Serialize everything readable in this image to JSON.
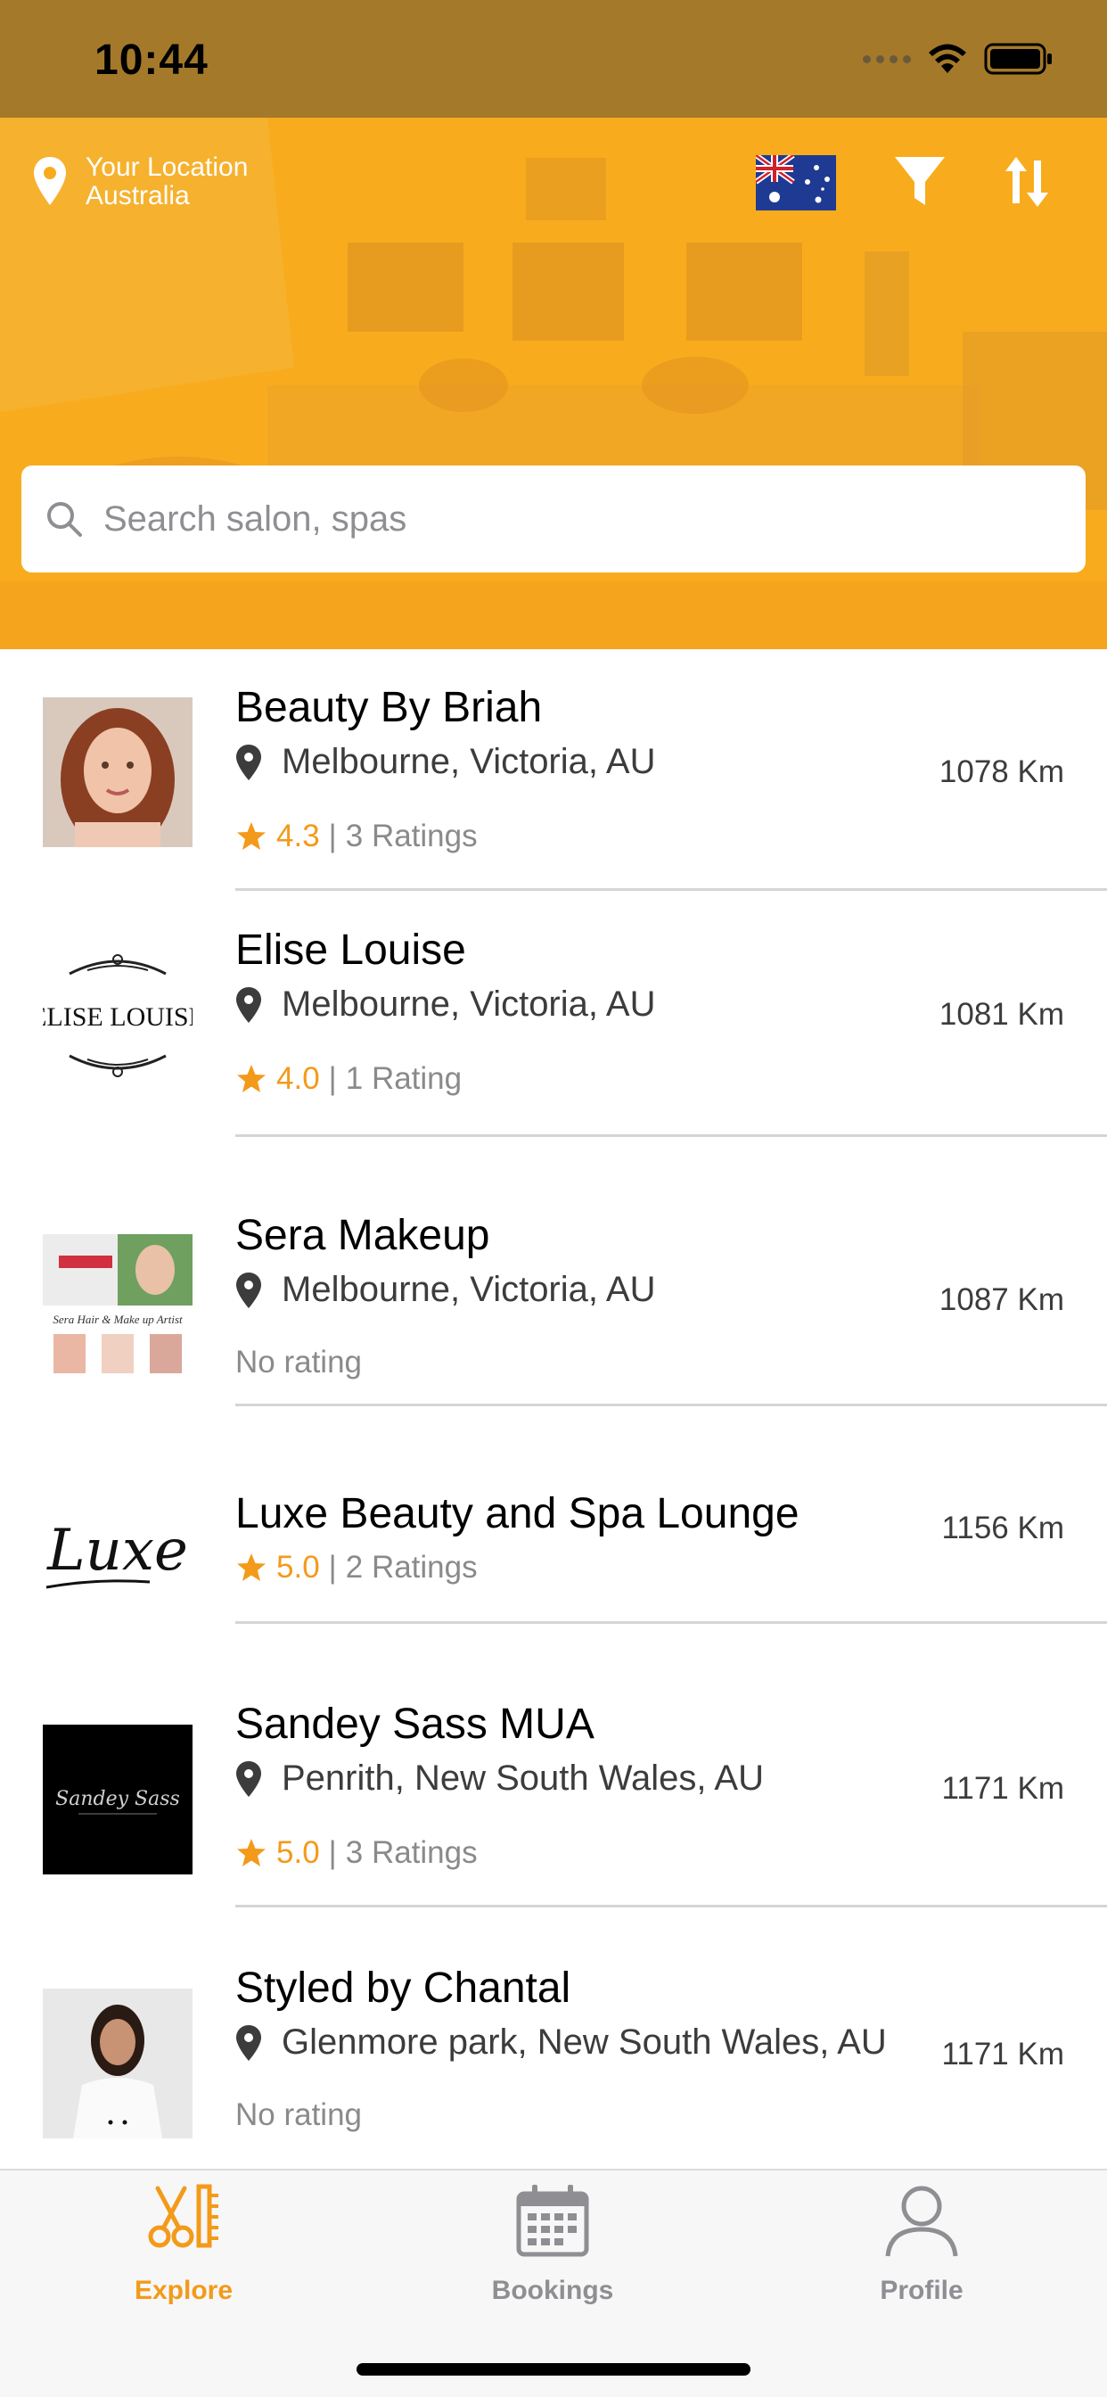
{
  "status_bar": {
    "time": "10:44"
  },
  "header": {
    "location_label": "Your Location",
    "location_value": "Australia",
    "flag": "australia-flag",
    "filter_icon": "filter-icon",
    "sort_icon": "sort-icon"
  },
  "search": {
    "placeholder": "Search salon, spas",
    "value": ""
  },
  "salons": [
    {
      "name": "Beauty By Briah",
      "location": "Melbourne, Victoria, AU",
      "rating": "4.3",
      "ratings_count": "3 Ratings",
      "distance": "1078 Km",
      "no_rating": ""
    },
    {
      "name": "Elise Louise",
      "location": "Melbourne, Victoria, AU",
      "rating": "4.0",
      "ratings_count": "1 Rating",
      "distance": "1081 Km",
      "no_rating": "",
      "logo_text": "ELISE LOUISE"
    },
    {
      "name": "Sera Makeup",
      "location": "Melbourne, Victoria, AU",
      "rating": "",
      "ratings_count": "",
      "distance": "1087 Km",
      "no_rating": "No rating",
      "logo_text": "Sera Hair & Make up Artist"
    },
    {
      "name": "Luxe Beauty and Spa Lounge",
      "location": "",
      "rating": "5.0",
      "ratings_count": "2 Ratings",
      "distance": "1156 Km",
      "no_rating": "",
      "logo_text": "Luxe"
    },
    {
      "name": "Sandey Sass MUA",
      "location": "Penrith, New South Wales, AU",
      "rating": "5.0",
      "ratings_count": "3 Ratings",
      "distance": "1171 Km",
      "no_rating": "",
      "logo_text": "Sandey Sass"
    },
    {
      "name": "Styled by Chantal",
      "location": "Glenmore park, New South Wales, AU",
      "rating": "",
      "ratings_count": "",
      "distance": "1171 Km",
      "no_rating": "No rating"
    }
  ],
  "tabs": [
    {
      "label": "Explore",
      "icon": "scissors-comb-icon",
      "active": true
    },
    {
      "label": "Bookings",
      "icon": "calendar-icon",
      "active": false
    },
    {
      "label": "Profile",
      "icon": "person-icon",
      "active": false
    }
  ],
  "colors": {
    "accent": "#f39a1a",
    "status_bar": "#a4792a",
    "hero": "#f8ac1d"
  }
}
